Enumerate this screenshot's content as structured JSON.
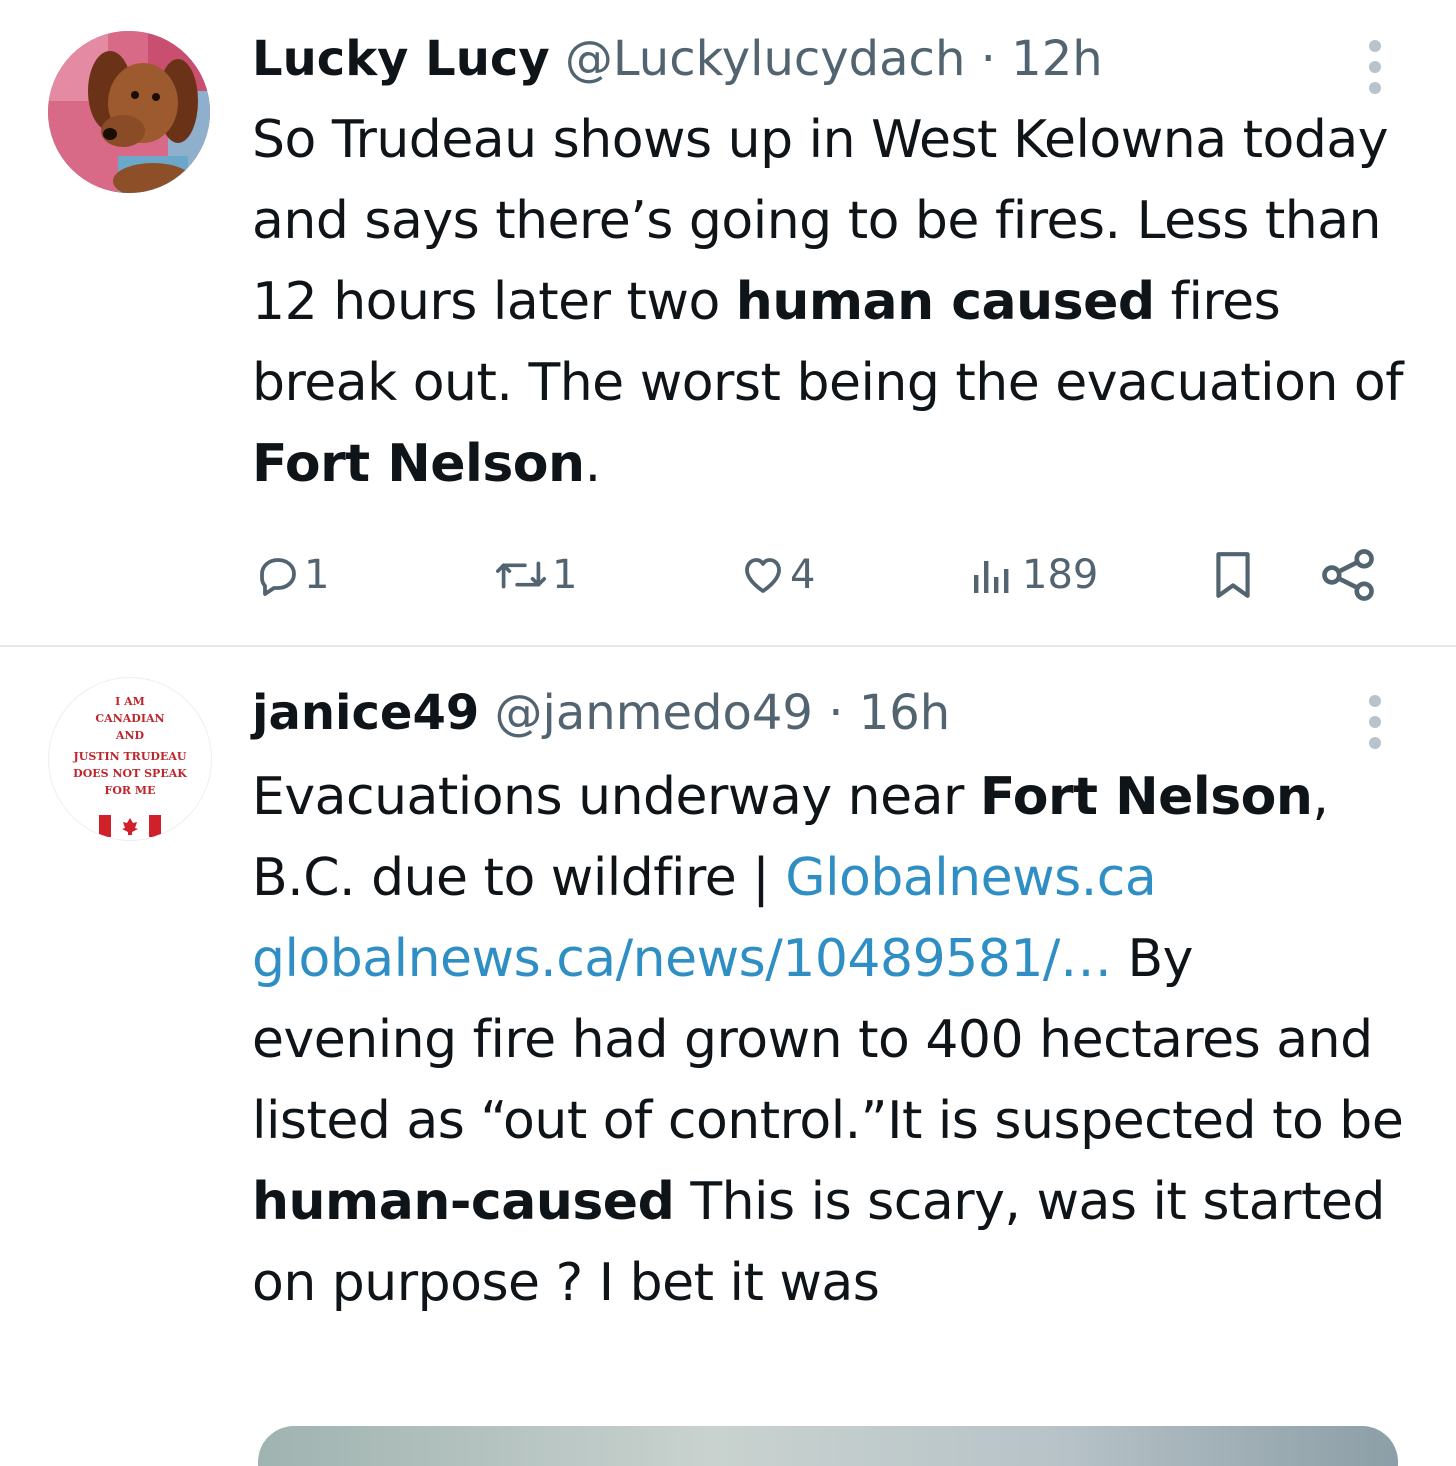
{
  "tweets": [
    {
      "name": "Lucky Lucy",
      "handle": "@Luckylucydach",
      "separator": "·",
      "time": "12h",
      "avatar_icon": "dachshund-avatar",
      "body": {
        "t1": "So Trudeau shows up in West Kelowna today and says there’s going to be fires. Less than 12 hours later two ",
        "b1": "human caused",
        "t2": " fires break out. The worst being the evacuation of ",
        "b2": "Fort Nelson",
        "t3": "."
      },
      "stats": {
        "replies": "1",
        "reposts": "1",
        "likes": "4",
        "views": "189"
      }
    },
    {
      "name": "janice49",
      "handle": "@janmedo49",
      "separator": "·",
      "time": "16h",
      "avatar_text": {
        "l1": "I AM",
        "l2": "CANADIAN",
        "l3": "AND",
        "l4": "JUSTIN TRUDEAU",
        "l5": "DOES NOT SPEAK",
        "l6": "FOR ME"
      },
      "body": {
        "t1": "Evacuations underway near ",
        "b1": "Fort Nelson",
        "t2": ", B.C. due to wildfire  | ",
        "link1": "Globalnews.ca",
        "link2": "globalnews.ca/news/10489581/…",
        "t3": " By evening fire had grown to 400 hectares and listed as “out of control.”It is suspected to be ",
        "b2": "human-caused",
        "t4": " This is scary, was it started on purpose ? I bet it was"
      }
    }
  ],
  "colors": {
    "text": "#0f1419",
    "secondary": "#536471",
    "link": "#2f8fc4",
    "divider": "#e6e9ec"
  },
  "icons": [
    "reply-icon",
    "repost-icon",
    "like-icon",
    "views-icon",
    "bookmark-icon",
    "share-icon",
    "more-icon"
  ]
}
